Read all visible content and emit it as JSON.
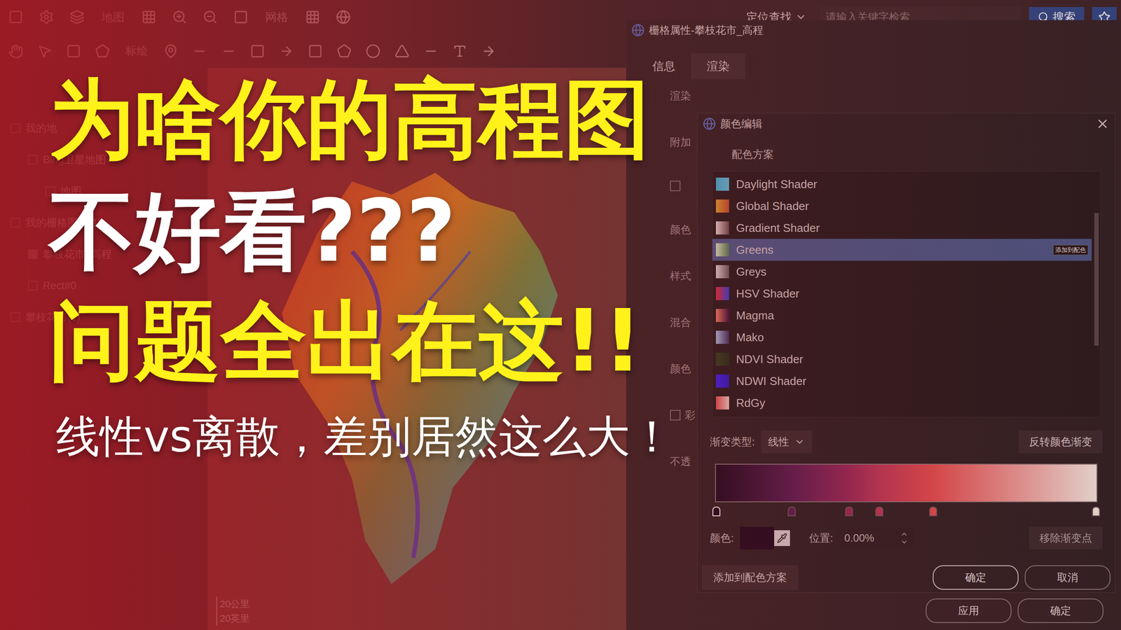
{
  "toolbar": {
    "row1_labels": [
      "地图",
      "网格"
    ],
    "locate": "定位查找",
    "search_placeholder": "请输入关键字检索",
    "search_button": "搜索",
    "row2_labels": [
      "标绘"
    ]
  },
  "layers": [
    {
      "label": "我的地",
      "checked": false,
      "indent": 0
    },
    {
      "label": "Bing卫星地图",
      "checked": false,
      "indent": 1
    },
    {
      "label": "地图_",
      "checked": false,
      "indent": 2
    },
    {
      "label": "我的栅格图层(1)",
      "checked": false,
      "indent": 0
    },
    {
      "label": "攀枝花市_高程",
      "checked": true,
      "indent": 1
    },
    {
      "label": "Rect#0",
      "checked": false,
      "indent": 1
    },
    {
      "label": "攀枝花市(1)",
      "checked": false,
      "indent": 0
    }
  ],
  "headline": {
    "line1": "为啥你的高程图",
    "line2": "不好看???",
    "line3": "问题全出在这!!",
    "subtitle": "线性vs离散，差别居然这么大！"
  },
  "map": {
    "scale": [
      "20公里",
      "20英里"
    ]
  },
  "raster_dialog": {
    "title": "栅格属性-攀枝花市_高程",
    "tabs": [
      {
        "label": "信息",
        "selected": false
      },
      {
        "label": "渲染",
        "selected": true
      }
    ],
    "rows": [
      {
        "kind": "label",
        "text": "渲染",
        "checked": false
      },
      {
        "kind": "label",
        "text": "附加",
        "checked": false
      },
      {
        "kind": "checkbox",
        "text": "",
        "checked": false
      },
      {
        "kind": "label",
        "text": "颜色",
        "checked": false
      },
      {
        "kind": "label",
        "text": "样式",
        "checked": false
      },
      {
        "kind": "label",
        "text": "混合",
        "checked": false
      },
      {
        "kind": "label",
        "text": "颜色",
        "checked": false
      },
      {
        "kind": "checkbox",
        "text": "彩",
        "checked": false
      },
      {
        "kind": "label",
        "text": "不透",
        "checked": false
      }
    ],
    "buttons": [
      "应用",
      "确定"
    ]
  },
  "color_editor": {
    "title": "颜色编辑",
    "scheme_label": "配色方案",
    "schemes": [
      {
        "name": "Daylight Shader",
        "colors": [
          "#3bb4d6",
          "#5ec0e0"
        ],
        "selected": false
      },
      {
        "name": "Global Shader",
        "colors": [
          "#e0a030",
          "#c05030"
        ],
        "selected": false
      },
      {
        "name": "Gradient Shader",
        "colors": [
          "#e8d8d8",
          "#6a4a4a"
        ],
        "selected": false
      },
      {
        "name": "Greens",
        "colors": [
          "#d8e8c8",
          "#508050"
        ],
        "selected": true
      },
      {
        "name": "Greys",
        "colors": [
          "#e0d8d8",
          "#6a5a5a"
        ],
        "selected": false
      },
      {
        "name": "HSV Shader",
        "colors": [
          "#e03030",
          "#3040e0"
        ],
        "selected": false
      },
      {
        "name": "Magma",
        "colors": [
          "#f08060",
          "#401040"
        ],
        "selected": false
      },
      {
        "name": "Mako",
        "colors": [
          "#a8c0e0",
          "#403060"
        ],
        "selected": false
      },
      {
        "name": "NDVI Shader",
        "colors": [
          "#304020",
          "#203018"
        ],
        "selected": false
      },
      {
        "name": "NDWI Shader",
        "colors": [
          "#3a20f0",
          "#2a18c0"
        ],
        "selected": false
      },
      {
        "name": "RdGy",
        "colors": [
          "#e05050",
          "#f0d0c8"
        ],
        "selected": false
      }
    ],
    "list_scroll": {
      "offset": 0.17,
      "size": 0.54
    },
    "tooltip": "添加到配色",
    "gradient_type_label": "渐变类型:",
    "gradient_type": "线性",
    "reverse_button": "反转颜色渐变",
    "stops": [
      {
        "position": 0.004,
        "color": "#1c0a1e",
        "selected": true
      },
      {
        "position": 0.2,
        "color": "#5a1e52",
        "selected": false
      },
      {
        "position": 0.35,
        "color": "#9a2a5a",
        "selected": false
      },
      {
        "position": 0.43,
        "color": "#c03a5a",
        "selected": false
      },
      {
        "position": 0.57,
        "color": "#e85050",
        "selected": false
      },
      {
        "position": 0.996,
        "color": "#faeee6",
        "selected": false
      }
    ],
    "color_label": "颜色:",
    "selected_color": "#1c0a1e",
    "position_label": "位置:",
    "position_value": "0.00%",
    "remove_button": "移除渐变点",
    "add_button": "添加到配色方案",
    "ok_button": "确定",
    "cancel_button": "取消"
  }
}
